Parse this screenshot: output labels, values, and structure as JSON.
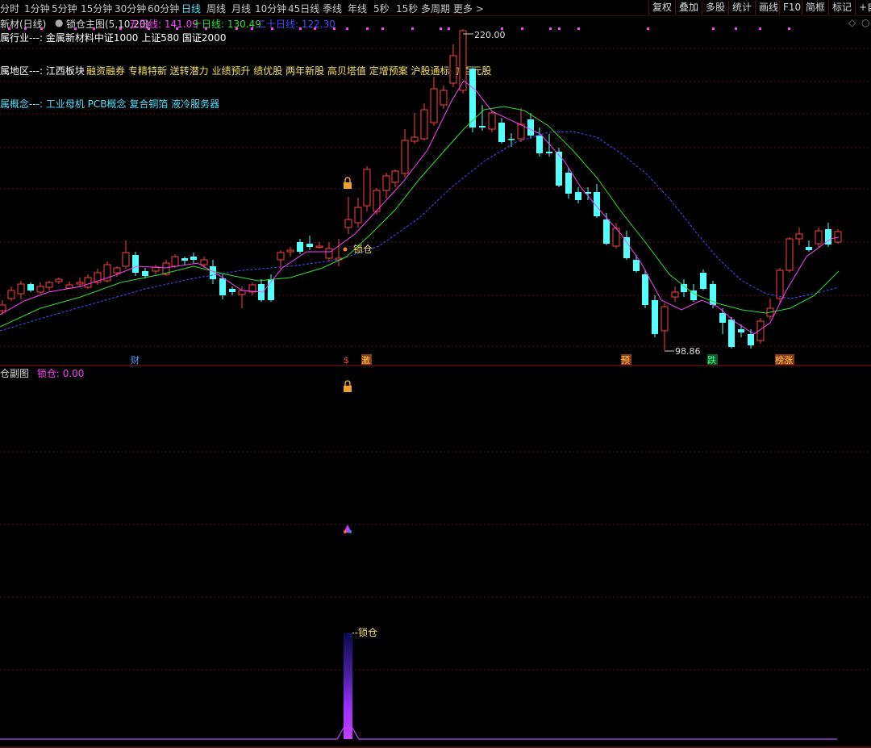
{
  "toolbar": {
    "periods": [
      "分时",
      "1分钟",
      "5分钟",
      "15分钟",
      "30分钟",
      "60分钟",
      "日线",
      "周线",
      "月线",
      "10分钟",
      "45日线",
      "季线",
      "年线",
      "5秒",
      "15秒",
      "多周期",
      "更多 >"
    ],
    "active_period": "日线",
    "right_buttons": [
      "复权",
      "叠加",
      "多股",
      "统计",
      "画线",
      "F10",
      "简框",
      "标记",
      "+自"
    ]
  },
  "header": {
    "stock": "新材(日线)",
    "indicator": "锁仓主图(5,10,20)",
    "ma5": "五日线: 141.09",
    "ma10": "十日线: 130.49",
    "ma20": "二十日线: 122.30"
  },
  "info": {
    "industry": "属行业---: 金属新材料中证1000 上证580 国证2000",
    "region_label": "属地区---: 江西板块",
    "region_tags": "融资融券 专精特新 送转潜力 业绩预升 绩优股 两年新股 高贝塔值 定增预案 沪股通标的 百元股",
    "concept": "属概念---: 工业母机 PCB概念 复合铜箔 液冷服务器"
  },
  "chart": {
    "high_label": "220.00",
    "low_label": "98.86",
    "lock_label": "锁仓",
    "event_labels": [
      "财",
      "$",
      "激",
      "预",
      "跌",
      "榜涨"
    ]
  },
  "sub": {
    "title": "仓副图",
    "value": "锁仓: 0.00",
    "lock_label": "---锁仓"
  },
  "colors": {
    "up": "#ff4040",
    "down": "#54ffff",
    "ma5": "#ff40ff",
    "ma10": "#30e030",
    "ma20": "#4848ff",
    "grid": "#5a0f0f"
  }
}
